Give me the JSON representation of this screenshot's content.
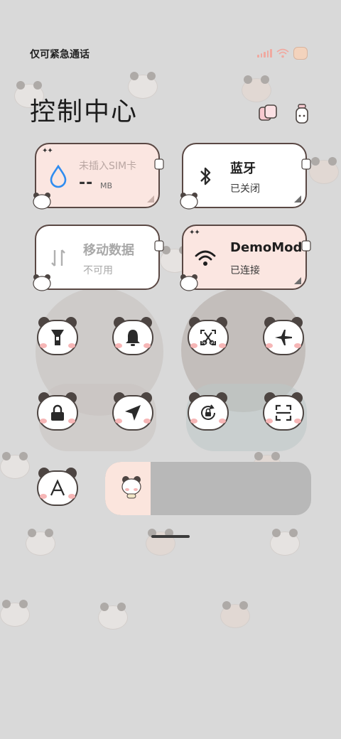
{
  "status_bar": {
    "carrier_text": "仅可紧急通话",
    "icons": [
      "signal-icon",
      "wifi-icon",
      "battery-icon"
    ]
  },
  "header": {
    "title": "控制中心",
    "icons": [
      "theme-icon",
      "bottle-icon"
    ]
  },
  "cards": {
    "data_usage": {
      "label": "未插入SIM卡",
      "value": "--",
      "unit": "MB",
      "icon": "water-drop-icon",
      "accent": "#2f8cf0"
    },
    "bluetooth": {
      "title": "蓝牙",
      "status": "已关闭",
      "icon": "bluetooth-icon"
    },
    "mobile_data": {
      "title": "移动数据",
      "status": "不可用",
      "icon": "mobile-data-icon"
    },
    "wifi": {
      "title": "DemoMode",
      "status": "已连接",
      "icon": "wifi-icon"
    }
  },
  "toggles": [
    {
      "name": "flashlight",
      "icon": "flashlight-icon"
    },
    {
      "name": "bell",
      "icon": "bell-icon"
    },
    {
      "name": "screenshot",
      "icon": "scissors-icon"
    },
    {
      "name": "airplane",
      "icon": "airplane-icon"
    },
    {
      "name": "lock",
      "icon": "lock-icon"
    },
    {
      "name": "location",
      "icon": "location-arrow-icon"
    },
    {
      "name": "rotation-lock",
      "icon": "rotation-lock-icon"
    },
    {
      "name": "scanner",
      "icon": "scan-icon"
    },
    {
      "name": "font-size",
      "icon": "font-icon",
      "glyph": "A"
    }
  ],
  "brightness": {
    "level": 0.22
  },
  "colors": {
    "background": "#d9d9d9",
    "card_pink": "#fbe6e1",
    "card_white": "#ffffff",
    "outline": "#4d4542",
    "cheek": "#f6b6b6"
  }
}
